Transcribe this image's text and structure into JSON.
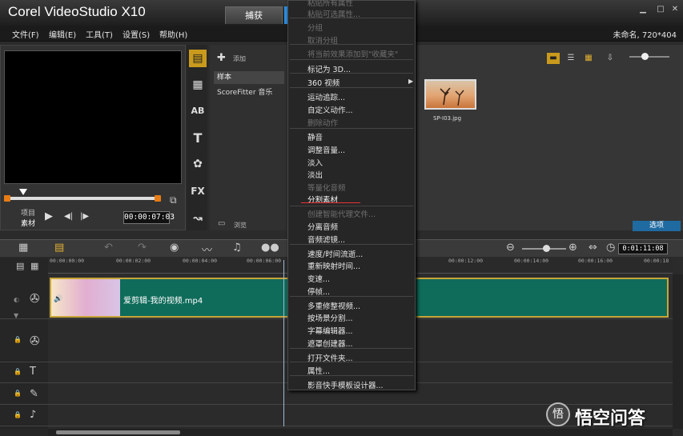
{
  "window": {
    "title": "Corel VideoStudio X10",
    "capture_tab": "捕获",
    "minimize_icon": "minimize-icon",
    "close_icon": "close-icon"
  },
  "menubar": {
    "items": [
      "文件(F)",
      "编辑(E)",
      "工具(T)",
      "设置(S)",
      "帮助(H)"
    ],
    "project_info": "未命名, 720*404"
  },
  "preview": {
    "mode_project": "项目",
    "mode_clip": "素材",
    "timecode": "00:00:07:03"
  },
  "library": {
    "add_label": "添加",
    "items": [
      "样本",
      "ScoreFitter 音乐"
    ],
    "browse_label": "浏览",
    "thumbnail_caption": "SP-I03.jpg",
    "options_label": "选项"
  },
  "context_menu": {
    "items": [
      {
        "label": "粘贴所有属性",
        "disabled": true
      },
      {
        "label": "粘贴可选属性...",
        "disabled": true
      },
      {
        "label": "分组",
        "disabled": true
      },
      {
        "label": "取消分组",
        "disabled": true
      },
      {
        "label": "将当前效果添加到\"收藏夹\"",
        "disabled": true
      },
      {
        "label": "标记为 3D...",
        "disabled": false
      },
      {
        "label": "360 视频",
        "disabled": false
      },
      {
        "label": "运动追踪...",
        "disabled": false
      },
      {
        "label": "自定义动作...",
        "disabled": false
      },
      {
        "label": "删除动作",
        "disabled": true
      },
      {
        "label": "静音",
        "disabled": false
      },
      {
        "label": "调整音量...",
        "disabled": false
      },
      {
        "label": "淡入",
        "disabled": false
      },
      {
        "label": "淡出",
        "disabled": false
      },
      {
        "label": "等量化音频",
        "disabled": true
      },
      {
        "label": "分割素材",
        "disabled": false
      },
      {
        "label": "创建智能代理文件...",
        "disabled": true
      },
      {
        "label": "分离音频",
        "disabled": false
      },
      {
        "label": "音频滤镜...",
        "disabled": false
      },
      {
        "label": "速度/时间流逝...",
        "disabled": false
      },
      {
        "label": "重新映射时间...",
        "disabled": false
      },
      {
        "label": "变速...",
        "disabled": false
      },
      {
        "label": "停帧...",
        "disabled": false
      },
      {
        "label": "多重修整视频...",
        "disabled": false
      },
      {
        "label": "按场景分割...",
        "disabled": false
      },
      {
        "label": "字幕编辑器...",
        "disabled": false
      },
      {
        "label": "遮罩创建器...",
        "disabled": false
      },
      {
        "label": "打开文件夹...",
        "disabled": false
      },
      {
        "label": "属性...",
        "disabled": false
      },
      {
        "label": "影音快手模板设计器...",
        "disabled": false
      }
    ],
    "highlighted_item": "分割素材"
  },
  "timeline": {
    "timecode": "0:01:11:08",
    "ruler_ticks": [
      "00:00:00:00",
      "00:00:02:00",
      "00:00:04:00",
      "00:00:06:00",
      "00:00:12:00",
      "00:00:14:00",
      "00:00:16:00",
      "00:00:18"
    ],
    "clip_name": "爱剪辑-我的视频.mp4"
  },
  "watermark": {
    "logo_glyph": "悟",
    "text": "悟空问答"
  }
}
